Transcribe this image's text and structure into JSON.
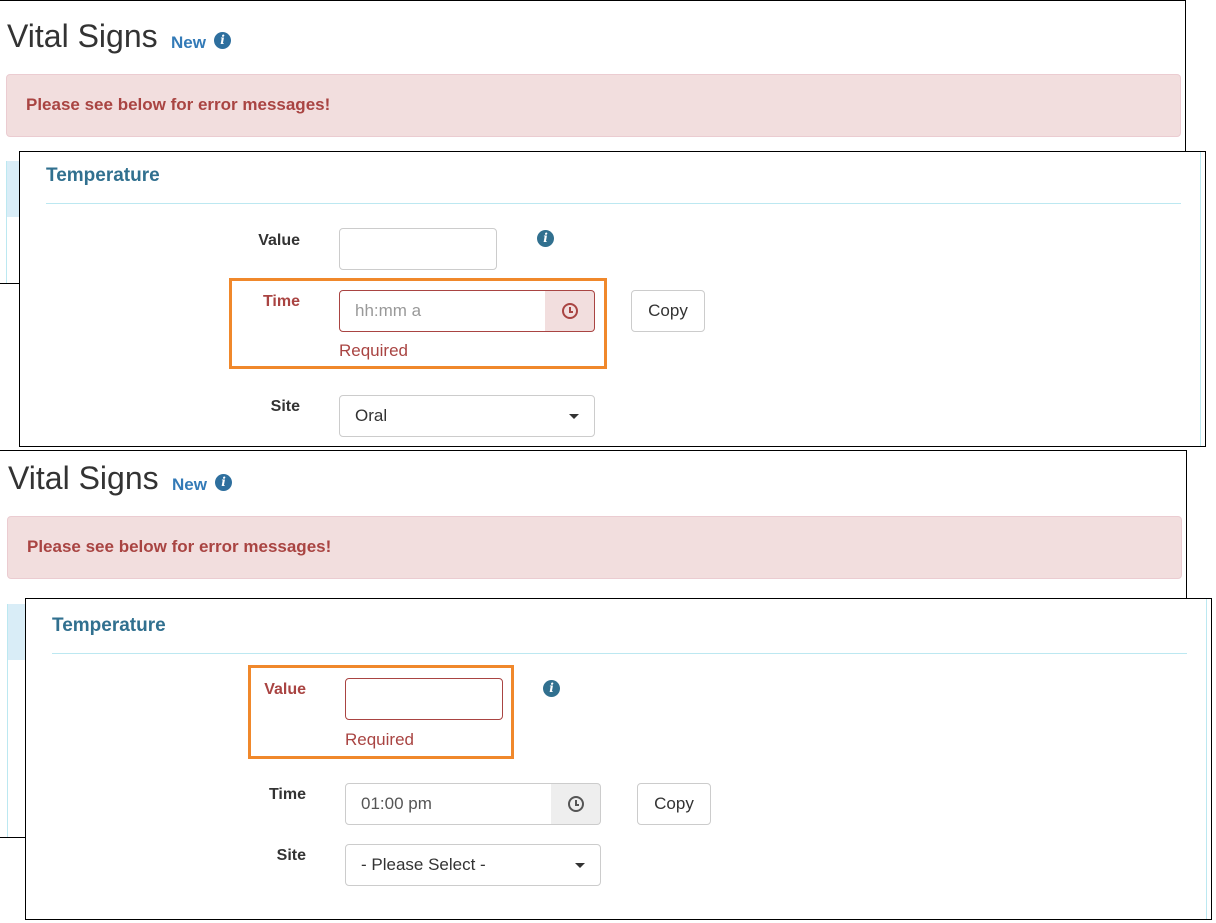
{
  "screens": [
    {
      "header": {
        "title": "Vital Signs",
        "new_label": "New"
      },
      "alert": {
        "text": "Please see below for error messages!"
      },
      "panel": {
        "title": "Temperature",
        "value_label": "Value",
        "value_input": "",
        "time_label": "Time",
        "time_placeholder": "hh:mm a",
        "time_input": "",
        "time_help": "Required",
        "copy_label": "Copy",
        "site_label": "Site",
        "site_selected": "Oral"
      }
    },
    {
      "header": {
        "title": "Vital Signs",
        "new_label": "New"
      },
      "alert": {
        "text": "Please see below for error messages!"
      },
      "panel": {
        "title": "Temperature",
        "value_label": "Value",
        "value_input": "",
        "value_help": "Required",
        "time_label": "Time",
        "time_input": "01:00 pm",
        "copy_label": "Copy",
        "site_label": "Site",
        "site_selected": "- Please Select -"
      }
    }
  ],
  "icons": {
    "info": "info-circle-icon",
    "clock": "clock-icon",
    "caret": "caret-down-icon"
  },
  "colors": {
    "error": "#a94442",
    "error_bg": "#f2dede",
    "panel_heading": "#31708f",
    "link": "#337ab7",
    "highlight": "#f0882b"
  }
}
